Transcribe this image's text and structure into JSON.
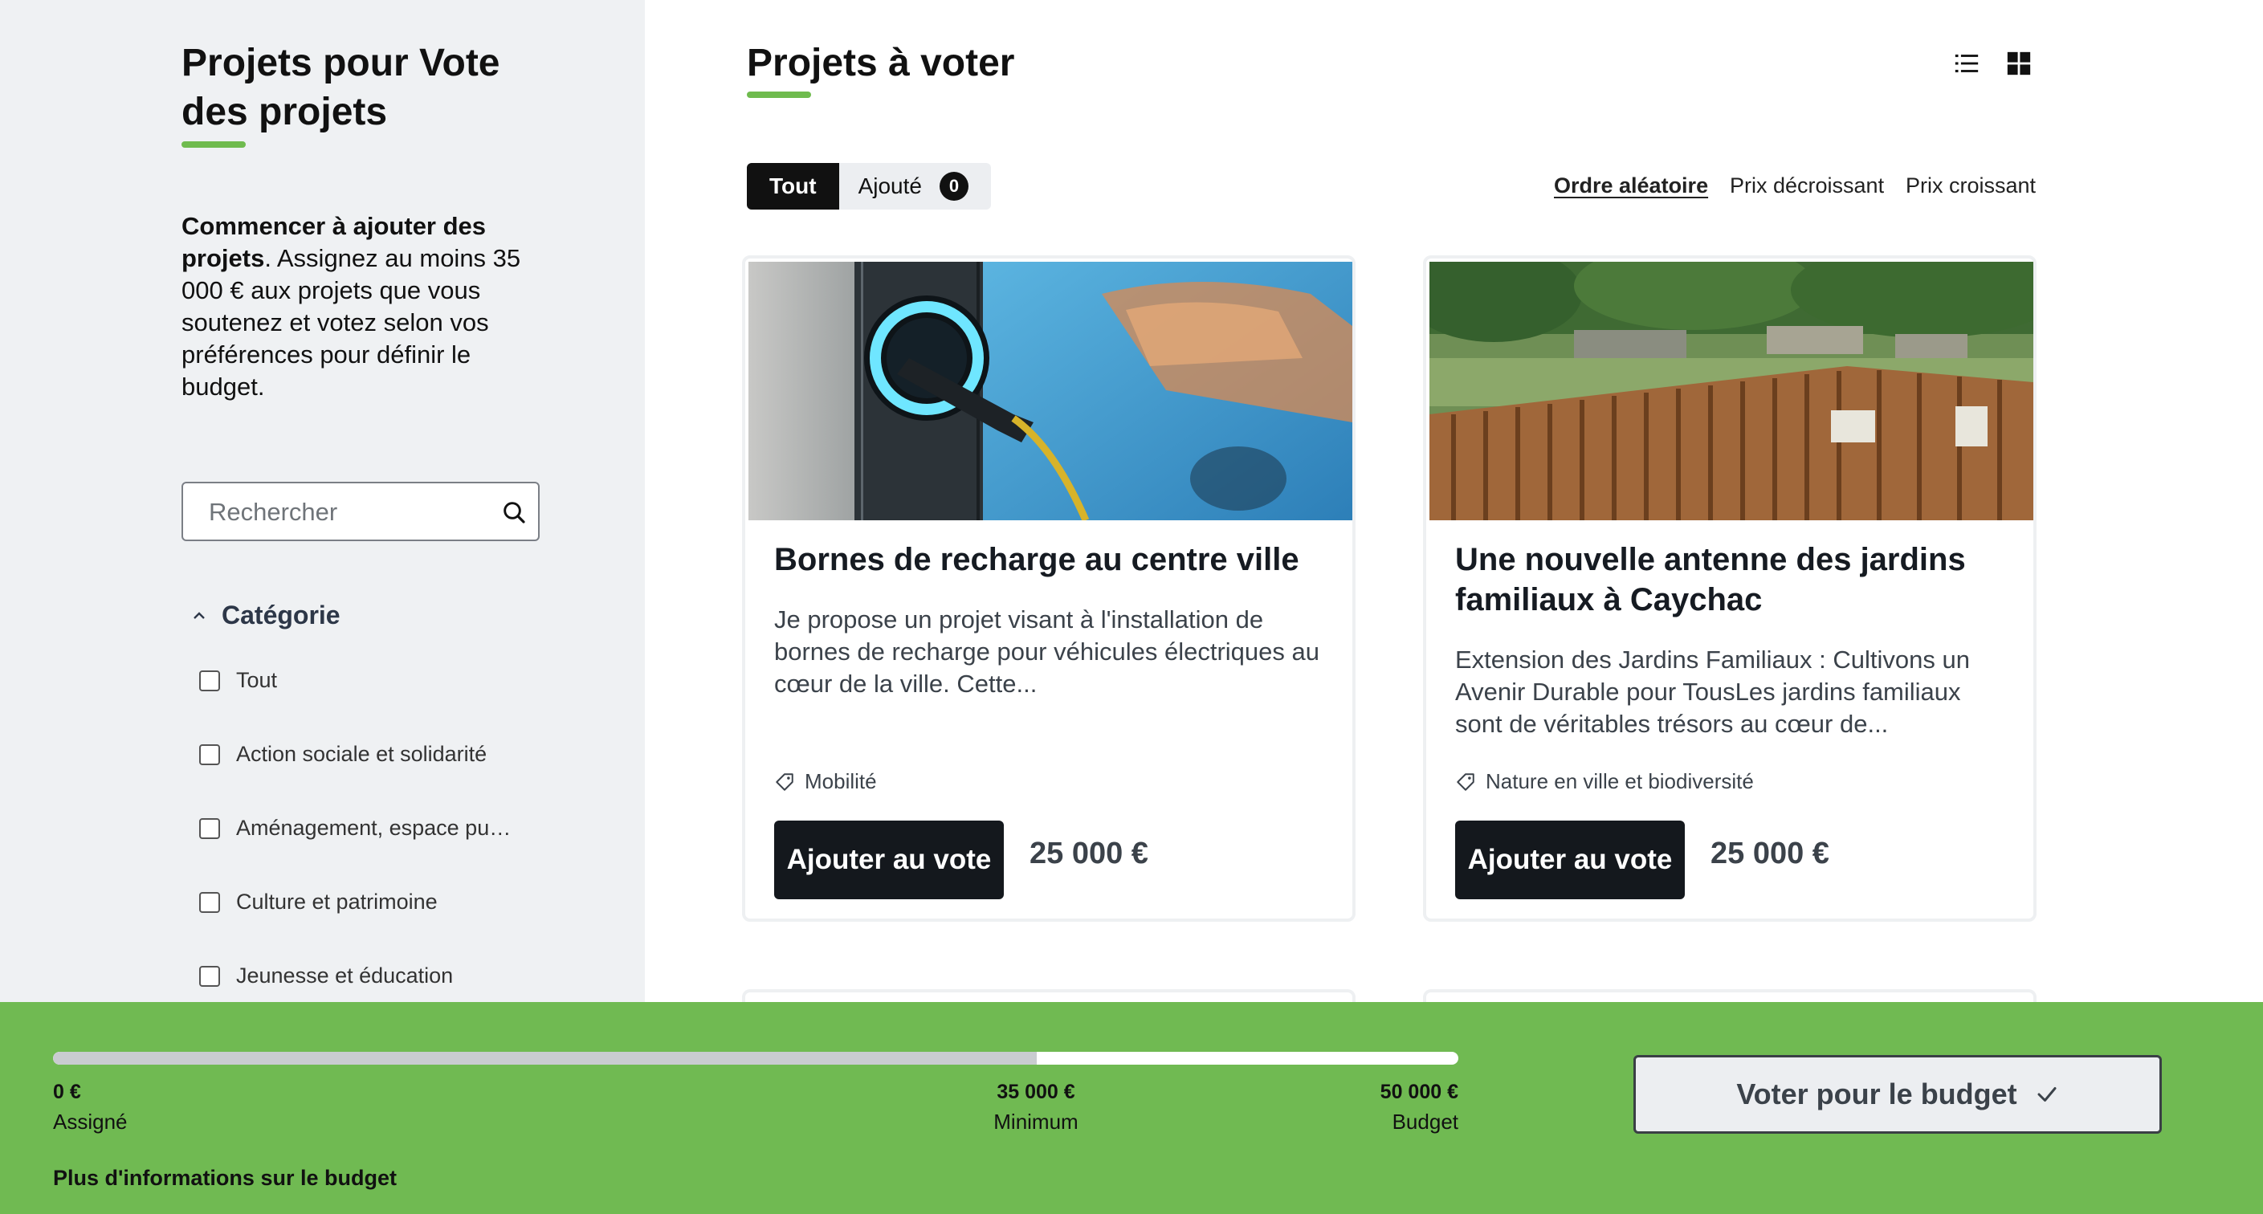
{
  "sidebar": {
    "title": "Projets pour Vote des projets",
    "intro_bold": "Commencer à ajouter des projets",
    "intro_rest": ". Assignez au moins 35 000 € aux projets que vous soutenez et votez selon vos préférences pour définir le budget.",
    "search_placeholder": "Rechercher",
    "category_heading": "Catégorie",
    "categories": [
      "Tout",
      "Action sociale et solidarité",
      "Aménagement, espace pu…",
      "Culture et patrimoine",
      "Jeunesse et éducation"
    ]
  },
  "main": {
    "title": "Projets à voter",
    "filters": {
      "all": "Tout",
      "added": "Ajouté",
      "added_count": "0"
    },
    "sort": {
      "random": "Ordre aléatoire",
      "price_desc": "Prix décroissant",
      "price_asc": "Prix croissant"
    },
    "projects": [
      {
        "title": "Bornes de recharge au centre ville",
        "description": "Je propose un projet visant à l'installation de bornes de recharge pour véhicules électriques au cœur de la ville. Cette...",
        "tag": "Mobilité",
        "button": "Ajouter au vote",
        "price": "25 000 €"
      },
      {
        "title": "Une nouvelle antenne des jardins familiaux à Caychac",
        "description": "Extension des Jardins Familiaux : Cultivons un Avenir Durable pour TousLes jardins familiaux sont de véritables trésors au cœur de...",
        "tag": "Nature en ville et biodiversité",
        "button": "Ajouter au vote",
        "price": "25 000 €"
      }
    ]
  },
  "footer": {
    "assigned_value": "0 €",
    "assigned_label": "Assigné",
    "minimum_value": "35 000 €",
    "minimum_label": "Minimum",
    "budget_value": "50 000 €",
    "budget_label": "Budget",
    "minimum_fraction": 0.7,
    "more_info": "Plus d'informations sur le budget",
    "vote_button": "Voter pour le budget"
  },
  "colors": {
    "accent_green": "#70ba52",
    "primary_dark": "#14181d",
    "sidebar_bg": "#eff1f3"
  }
}
